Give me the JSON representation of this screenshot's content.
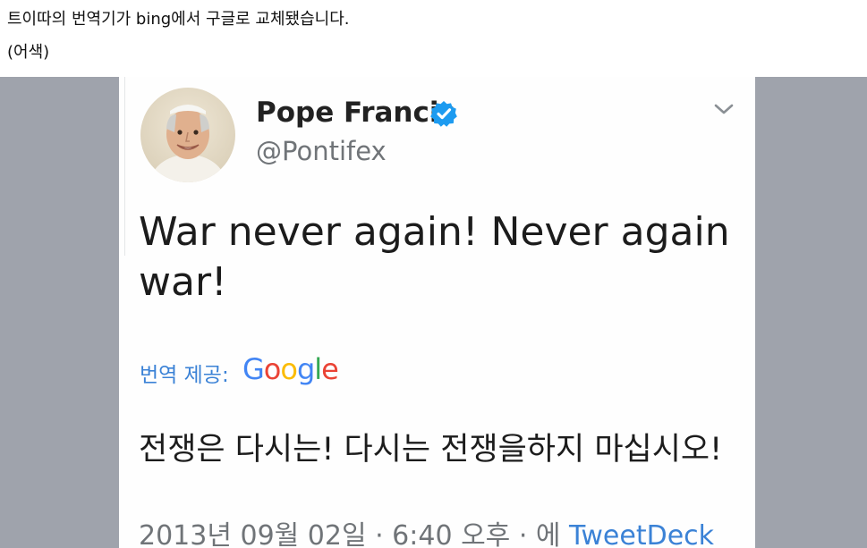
{
  "post": {
    "line1": "트이따의 번역기가 bing에서 구글로 교체됐습니다.",
    "line2": "(어색)"
  },
  "tweet": {
    "display_name": "Pope Francis",
    "handle": "@Pontifex",
    "verified_icon": "verified-badge-icon",
    "menu_icon": "chevron-down-icon",
    "text": "War never again! Never again war!",
    "translated_by_label": "번역 제공:",
    "translation_provider": "Google",
    "translated_text": "전쟁은 다시는! 다시는 전쟁을하지 마십시오!",
    "timestamp": "2013년 09월 02일 · 6:40 오후 · 에 ",
    "via": "TweetDeck"
  },
  "colors": {
    "link_blue": "#3b82d6",
    "verified_blue": "#1d9bf0",
    "outer_background": "#9fa3ac",
    "google_blue": "#4285f4",
    "google_red": "#ea4335",
    "google_yellow": "#fbbc05",
    "google_green": "#34a853"
  }
}
